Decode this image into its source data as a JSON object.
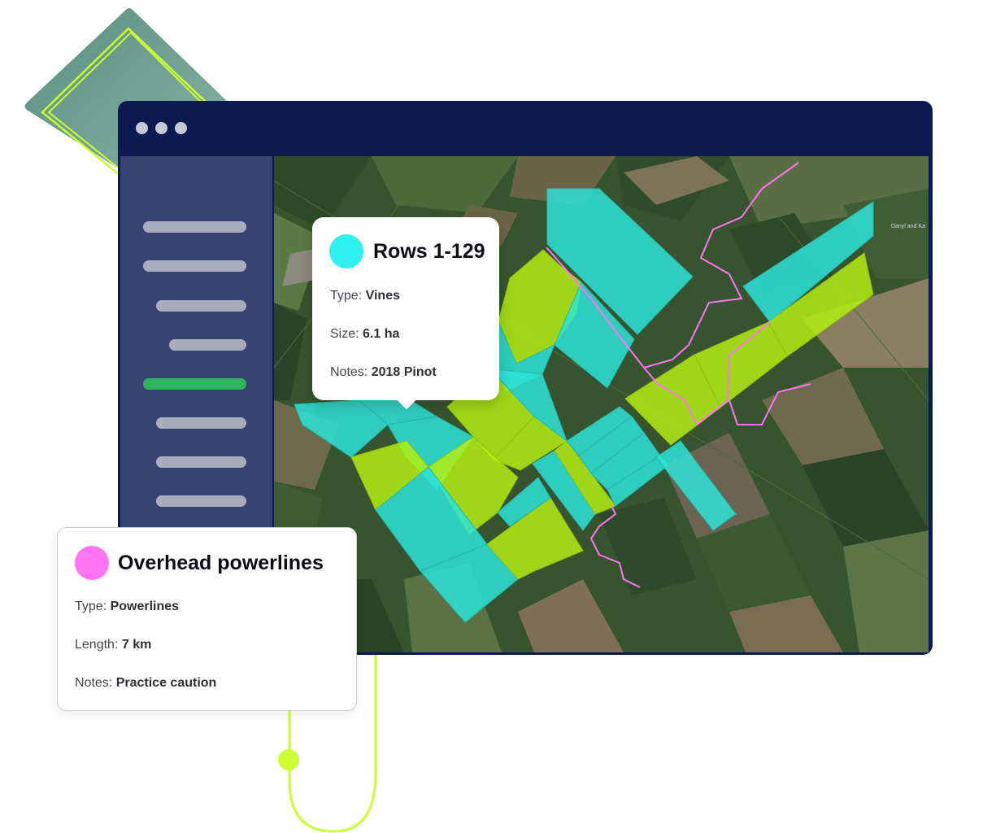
{
  "colors": {
    "vines_field": "#2ef0ee",
    "vines_field_alt": "#b2ef12",
    "powerline": "#ff73f3",
    "accent_green": "#2fb45f",
    "window_frame": "#0c1a4f",
    "sidebar": "#374372"
  },
  "sidebar": {
    "active_index": 4,
    "item_count": 8
  },
  "map": {
    "credit": "Danyl and Ka"
  },
  "cards": {
    "rows": {
      "title": "Rows 1-129",
      "type_label": "Type:",
      "type_value": "Vines",
      "size_label": "Size:",
      "size_value": "6.1 ha",
      "notes_label": "Notes:",
      "notes_value": "2018 Pinot"
    },
    "powerlines": {
      "title": "Overhead powerlines",
      "type_label": "Type:",
      "type_value": "Powerlines",
      "length_label": "Length:",
      "length_value": "7 km",
      "notes_label": "Notes:",
      "notes_value": "Practice caution"
    }
  }
}
